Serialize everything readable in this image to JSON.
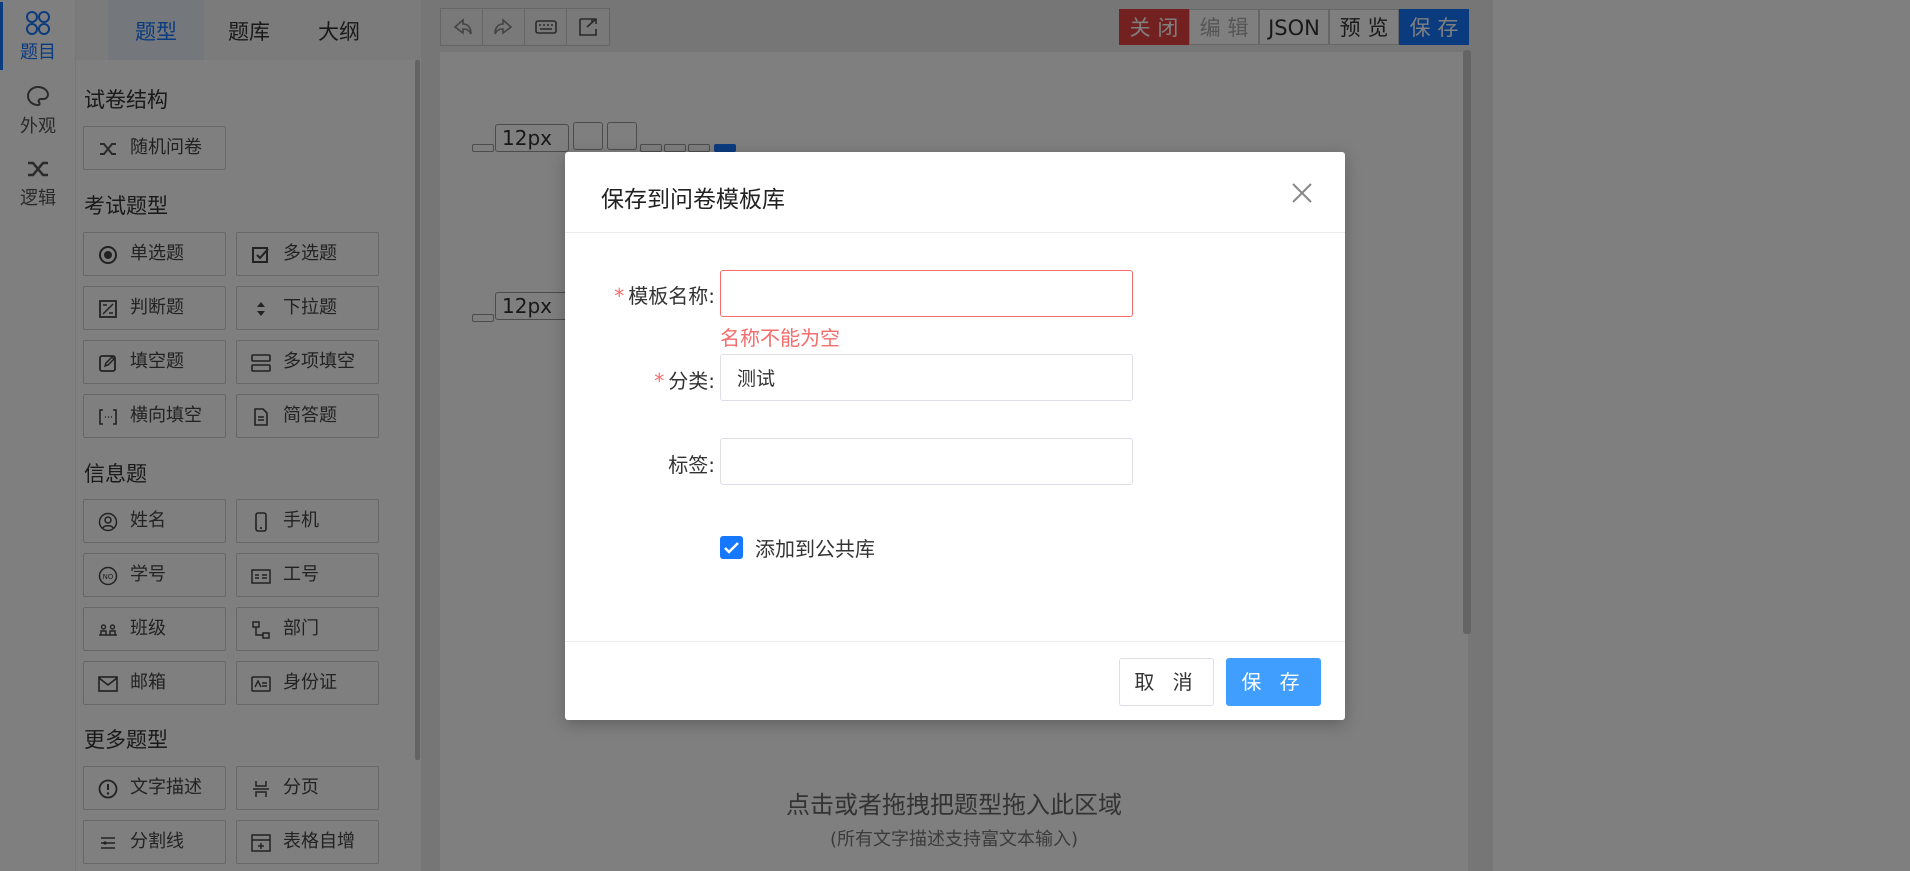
{
  "rail": [
    {
      "label": "题目",
      "icon": "grid-circles-icon",
      "active": true
    },
    {
      "label": "外观",
      "icon": "palette-icon"
    },
    {
      "label": "逻辑",
      "icon": "shuffle-icon"
    }
  ],
  "tabs": [
    "题型",
    "题库",
    "大纲"
  ],
  "sections": {
    "structure": {
      "title": "试卷结构",
      "items": [
        {
          "label": "随机问卷",
          "icon": "shuffle-icon"
        }
      ]
    },
    "exam": {
      "title": "考试题型",
      "items": [
        {
          "label": "单选题",
          "icon": "radio-icon"
        },
        {
          "label": "多选题",
          "icon": "checkbox-icon"
        },
        {
          "label": "判断题",
          "icon": "judge-icon"
        },
        {
          "label": "下拉题",
          "icon": "dropdown-icon"
        },
        {
          "label": "填空题",
          "icon": "edit-icon"
        },
        {
          "label": "多项填空",
          "icon": "multi-fill-icon"
        },
        {
          "label": "横向填空",
          "icon": "bracket-fill-icon"
        },
        {
          "label": "简答题",
          "icon": "document-icon"
        }
      ]
    },
    "info": {
      "title": "信息题",
      "items": [
        {
          "label": "姓名",
          "icon": "user-icon"
        },
        {
          "label": "手机",
          "icon": "phone-icon"
        },
        {
          "label": "学号",
          "icon": "number-icon"
        },
        {
          "label": "工号",
          "icon": "badge-icon"
        },
        {
          "label": "班级",
          "icon": "class-icon"
        },
        {
          "label": "部门",
          "icon": "org-icon"
        },
        {
          "label": "邮箱",
          "icon": "mail-icon"
        },
        {
          "label": "身份证",
          "icon": "idcard-icon"
        }
      ]
    },
    "more": {
      "title": "更多题型",
      "items": [
        {
          "label": "文字描述",
          "icon": "info-icon"
        },
        {
          "label": "分页",
          "icon": "page-break-icon"
        },
        {
          "label": "分割线",
          "icon": "divider-icon"
        },
        {
          "label": "表格自增",
          "icon": "table-add-icon"
        }
      ]
    }
  },
  "actions": {
    "close": "关 闭",
    "edit": "编 辑",
    "json": "JSON",
    "preview": "预 览",
    "save": "保 存"
  },
  "format": {
    "font_size": "12px"
  },
  "drop": {
    "hint": "点击或者拖拽把题型拖入此区域",
    "sub": "(所有文字描述支持富文本输入)"
  },
  "dialog": {
    "title": "保存到问卷模板库",
    "fields": {
      "name_label": "模板名称:",
      "name_value": "",
      "name_error": "名称不能为空",
      "category_label": "分类:",
      "category_value": "测试",
      "tags_label": "标签:",
      "tags_value": ""
    },
    "checkbox": {
      "label": "添加到公共库",
      "checked": true
    },
    "cancel": "取 消",
    "save": "保 存"
  },
  "colors": {
    "primary": "#409eff",
    "danger": "#f56c6c",
    "close_btn": "#e64340",
    "save_btn": "#1677ff"
  }
}
